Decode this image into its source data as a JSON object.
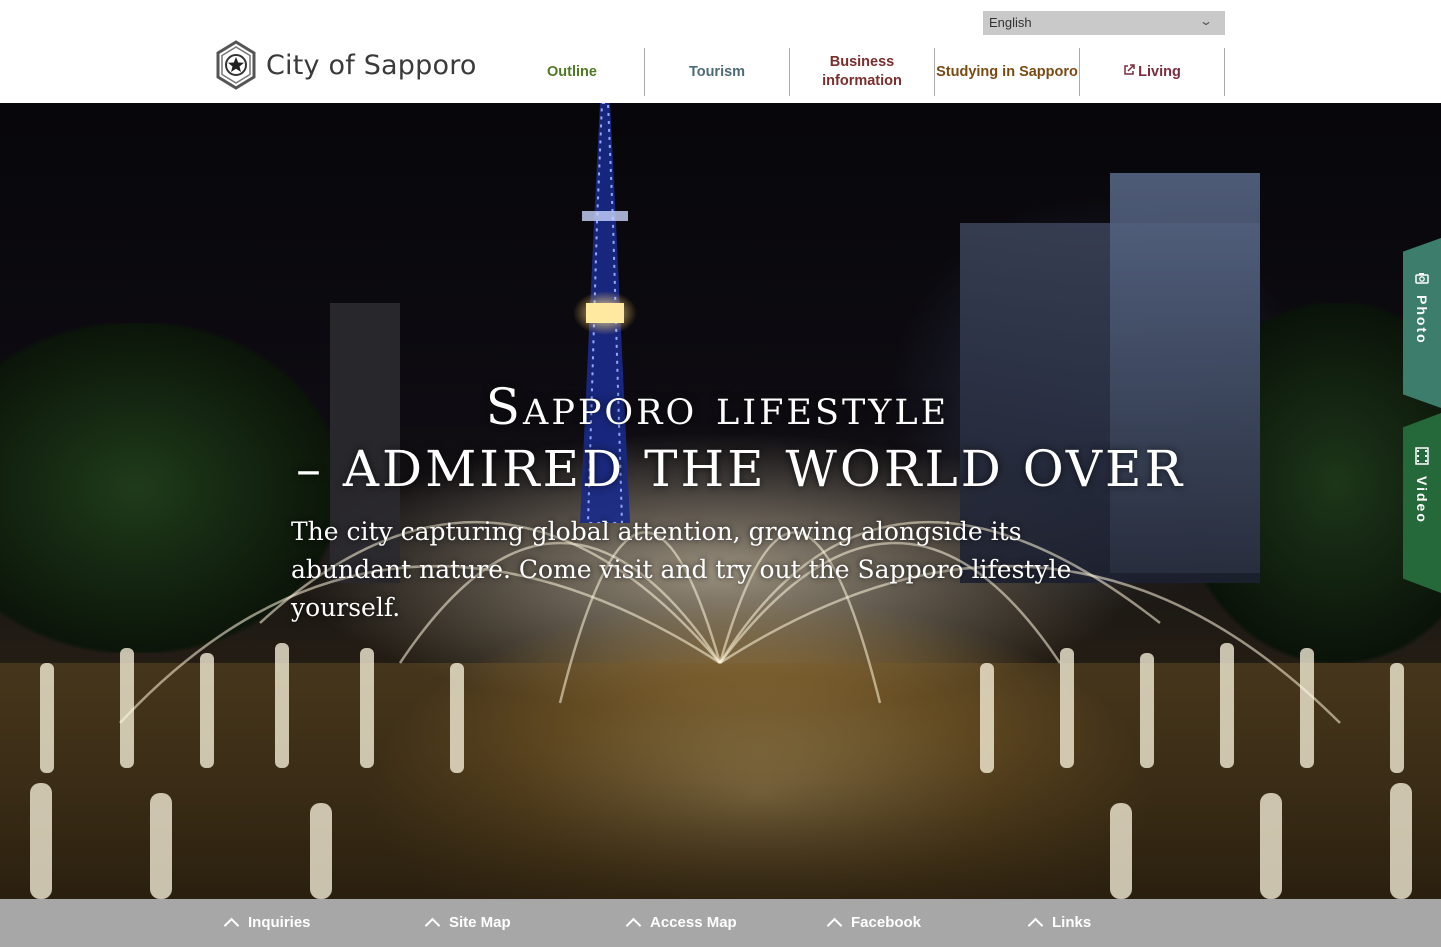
{
  "header": {
    "language": {
      "selected": "English",
      "chevron_icon": "chevron-down-icon"
    },
    "logo": {
      "text": "City of Sapporo",
      "icon": "city-emblem-icon"
    },
    "nav": [
      {
        "label": "Outline",
        "color": "#4f7a24"
      },
      {
        "label": "Tourism",
        "color": "#4e6a79"
      },
      {
        "label": "Business information",
        "color": "#7a2e2e"
      },
      {
        "label": "Studying in Sapporo",
        "color": "#7a4a13"
      },
      {
        "label": "Living",
        "color": "#7a2e3e",
        "icon": "external-link-icon"
      }
    ]
  },
  "hero": {
    "title_line1": "Sapporo lifestyle",
    "title_line2": "– admired the world over",
    "subtitle": "The city capturing global attention, growing alongside its abundant nature. Come visit and try out the Sapporo lifestyle yourself."
  },
  "side_tabs": [
    {
      "label": "Photo",
      "icon": "camera-icon",
      "color": "#3c7d6b"
    },
    {
      "label": "Video",
      "icon": "film-icon",
      "color": "#25683a"
    }
  ],
  "footer": {
    "items": [
      {
        "label": "Inquiries"
      },
      {
        "label": "Site Map"
      },
      {
        "label": "Access Map"
      },
      {
        "label": "Facebook"
      },
      {
        "label": "Links"
      }
    ],
    "background": "#a7a7a7"
  }
}
